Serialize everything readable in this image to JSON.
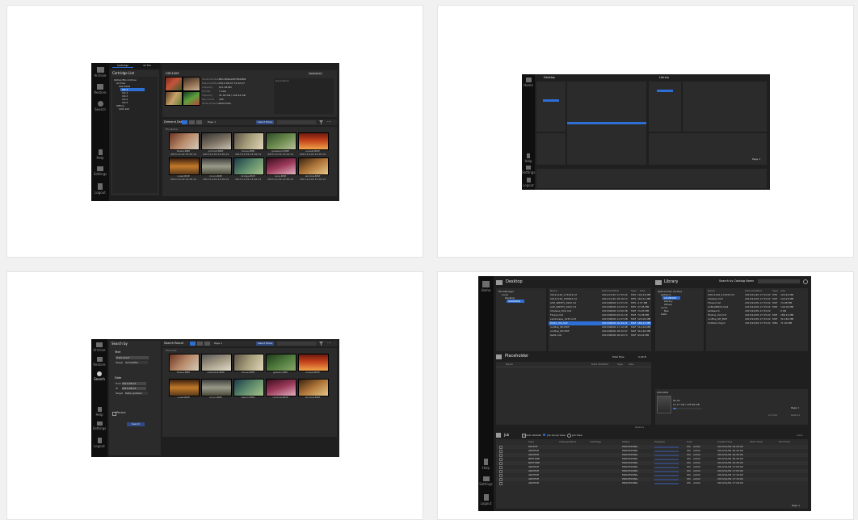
{
  "rail": {
    "s1": [
      "Archive",
      "Restore",
      "Search",
      "Help",
      "Settings",
      "Logout"
    ],
    "s3": [
      "Archive",
      "Restore",
      "Search",
      "Help",
      "Settings",
      "Logout"
    ],
    "s4": [
      "Home",
      "Help",
      "Settings",
      "Logout"
    ]
  },
  "s1": {
    "tabs": [
      "Cartridge",
      "All File"
    ],
    "list_title": "Cartridge List",
    "tree": [
      "OptiarcBlu Archive",
      "Archive",
      "CDC1009",
      "CD-1",
      "CD-2",
      "CD-3",
      "CD-4",
      "CD-5",
      "Offline",
      "CD5-100"
    ],
    "selected_title": "CDC1009",
    "info_labels": [
      "Serial Number",
      "Date Modified",
      "Capacity",
      "Format",
      "Capacity",
      "File Count",
      "Write Protected"
    ],
    "info_values": [
      "B01-NWAA0078K0909",
      "2013-08-07 14:22:47",
      "$11,96 Bm",
      "Y bam",
      "41.44 GB / 104.44 GB",
      "182",
      "Automatic"
    ],
    "description_label": "Description",
    "top_right": "Refreshed",
    "toolbar_title": "Demand Data",
    "page_label": "Page 1",
    "select_mode": "Select Mode",
    "folder_label": "File Name",
    "thumbs": [
      "flower.BMP",
      "portrait.BMP",
      "house.BMP",
      "grassland.BMP",
      "sunset.BMP",
      "coast.BMP",
      "moon.BMP",
      "bridge.BMP",
      "cave.BMP",
      "window.BMP"
    ],
    "thumb_dates": [
      "2013-12-09 13:26:14",
      "2013-12-09 13:26:14",
      "2013-12-09 13:26:14",
      "2013-12-09 13:26:14",
      "2013-12-09 13:26:14",
      "2013-12-09 13:26:14",
      "2013-12-09 13:26:14",
      "2013-12-09 13:26:14",
      "2013-12-09 13:26:14",
      "2013-12-09 13:26:14"
    ]
  },
  "s2": {
    "desktop": "Desktop",
    "library": "Library",
    "page": "Page 1",
    "nav_items": [
      "Home",
      "Help",
      "Settings",
      "Logout"
    ]
  },
  "s3": {
    "search_by": "Search by",
    "text_label": "Text",
    "text_value": "Date.ntext",
    "target_label": "Target",
    "target_value": "Archivefile",
    "date_label": "Date",
    "from_label": "From",
    "from_value": "2013-08-07",
    "to_label": "To",
    "to_value": "2013-08-22",
    "target2_value": "Date updated",
    "person_label": "Person",
    "search_button": "Search",
    "result_title": "Search Result",
    "page_label": "Page 1",
    "select_mode": "Select Mode",
    "folder_label": "Filename",
    "thumbs": [
      "flower.BMP",
      "cathedral.BMP",
      "house.BMP",
      "gazebo.BMP",
      "sunset.BMP",
      "coast.BMP",
      "moon.BMP",
      "beach.BMP",
      "rainbow.BMP",
      "window.BMP"
    ]
  },
  "s4": {
    "desktop_title": "Desktop",
    "library_title": "Library",
    "search_by": "Search by Catalog Name",
    "fm_tree": [
      "File Manager",
      "Local",
      "Desktop",
      "A0000000"
    ],
    "desk_cols": [
      "Name",
      "Date Modified",
      "Type",
      "Size"
    ],
    "desk_rows": [
      [
        "20111120_174153.mt",
        "2011/11/20 17:33:22",
        "MTS",
        "194.16 MB"
      ],
      [
        "20111120_180932.mt",
        "2011/11/20 18:10:13",
        "MTS",
        "164.11 MB"
      ],
      [
        "ACE_WIDTH_1920.mt",
        "2013/08/06 11:57:23",
        "MTS",
        "2.37 MB"
      ],
      [
        "ACE_WIDTH_1932.mt",
        "2013/08/06 12:03:14",
        "MTS",
        "27.65 MB"
      ],
      [
        "Chelsea_CDA.mxf",
        "2013/08/06 13:09:38",
        "MXF",
        "74.03 MB"
      ],
      [
        "Flower.mxf",
        "2013/08/06 09:21:18",
        "MXF",
        "74.08 MB"
      ],
      [
        "Landscape_1234.mxf",
        "2013/08/06 11:27:08",
        "MXF",
        "120.04 MB"
      ],
      [
        "Photo_Vid.mxf",
        "2013/08/06 10:44:21",
        "MXF",
        "186.10 MB"
      ],
      [
        "rooftop_0H.MXF",
        "2013/08/06 17:12:48",
        "MXF",
        "512.00 MB"
      ],
      [
        "rooftop_0H.MXF",
        "2013/08/06 18:33:07",
        "MXF",
        "312.64 MB"
      ],
      [
        "test1.mxf",
        "2013/08/06 16:52:13",
        "MXF",
        "94.24 MB"
      ]
    ],
    "lib_tree": [
      "Optical Disc Archive",
      "Optiarcs",
      "AX180001",
      "Library",
      "Others",
      "Local",
      "Nas",
      "Data"
    ],
    "lib_cols": [
      "Name",
      "Date Modified",
      "Type",
      "Size"
    ],
    "lib_rows": [
      [
        "20111120_174153.mt",
        "2013/11/20 17:33:22",
        "MTS",
        "104.16 MB"
      ],
      [
        "Chelsea.mxf",
        "2013/12/09 17:33:22",
        "MXF",
        "120.16 MB"
      ],
      [
        "Flower.mxf",
        "2013/12/09 17:33:22",
        "MXF",
        "74.08 MB"
      ],
      [
        "AnBoxBlitzV.mp4",
        "2013/12/09 17:33:22",
        "MP4",
        "140.06 MB"
      ],
      [
        "Ashbeach",
        "2013/12/09 17:33:22",
        "",
        "0 KB"
      ],
      [
        "Photos_Vid.mxf",
        "2013/12/09 17:33:22",
        "MXF",
        "186.10 MB"
      ],
      [
        "rooftop_0H_MXF",
        "2013/12/09 17:33:22",
        "MXF",
        "312.64 MB"
      ],
      [
        "Untitled Img.it",
        "2013/12/09 17:33:22",
        "MPG",
        "71.00 MB"
      ]
    ],
    "placeholder_title": "Placeholder",
    "total_label": "Total Files",
    "total_value": "0.00 B",
    "ph_cols": [
      "Name",
      "Date Modified",
      "Type",
      "Size"
    ],
    "cart_label": "CDC1009",
    "cart_info": [
      "QL-01",
      "11.17 GB / 105.99 GB"
    ],
    "lib_page": "Page 1",
    "archive_button": "Archive",
    "restore_button": "Restore",
    "jobs_title": "Job",
    "jobs_opts": [
      "Auto Refresh",
      "Job Group View",
      "Job View"
    ],
    "jobs_clear": "Clear",
    "job_cols": [
      "Type",
      "Catalog Name",
      "Cartridge",
      "Status",
      "Progress",
      "User",
      "Create Time",
      "Start Time",
      "End Time"
    ],
    "job_rows": [
      [
        "DELETE",
        "",
        "",
        "PROCESSING",
        "",
        "Ufs",
        "admin",
        "2013/12/09 16:20:00"
      ],
      [
        "ARCHIVE",
        "",
        "",
        "PROCESSING",
        "",
        "Ufs",
        "admin",
        "2013/12/09 16:25:00"
      ],
      [
        "ARCHIVE",
        "",
        "",
        "PROCESSING",
        "",
        "Ufs",
        "admin",
        "2013/12/09 16:35:00"
      ],
      [
        "RESTORE",
        "",
        "",
        "PROCESSING",
        "",
        "Ufs",
        "admin",
        "2013/12/09 16:40:00"
      ],
      [
        "RESTORE",
        "",
        "",
        "PROCESSING",
        "",
        "Ufs",
        "admin",
        "2013/12/09 16:45:00"
      ],
      [
        "ARCHIVE",
        "",
        "",
        "PROCESSING",
        "",
        "Ufs",
        "admin",
        "2013/12/09 17:00:00"
      ],
      [
        "ARCHIVE",
        "",
        "",
        "PROCESSING",
        "",
        "Ufs",
        "admin",
        "2013/12/09 17:05:00"
      ],
      [
        "ARCHIVE",
        "",
        "",
        "PROCESSING",
        "",
        "Ufs",
        "admin",
        "2013/12/09 17:10:00"
      ],
      [
        "ARCHIVE",
        "",
        "",
        "PROCESSING",
        "",
        "Ufs",
        "admin",
        "2013/12/09 17:15:00"
      ],
      [
        "ARCHIVE",
        "",
        "",
        "PROCESSING",
        "",
        "Ufs",
        "admin",
        "2013/12/09 17:20:00"
      ]
    ],
    "job_page": "Page 1"
  }
}
